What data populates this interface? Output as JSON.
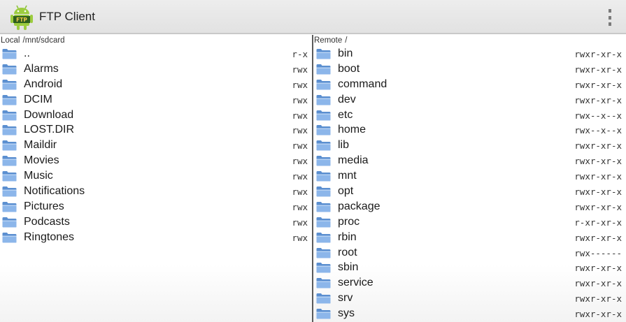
{
  "app": {
    "title": "FTP Client",
    "icon": "android-ftp-icon",
    "icon_text": "FTP"
  },
  "colors": {
    "actionbar": "#e6e6e6",
    "divider": "#5a5a5a",
    "folder": "#6f9fd8"
  },
  "local": {
    "label": "Local",
    "path": "/mnt/sdcard",
    "items": [
      {
        "name": "..",
        "perm": "r-x"
      },
      {
        "name": "Alarms",
        "perm": "rwx"
      },
      {
        "name": "Android",
        "perm": "rwx"
      },
      {
        "name": "DCIM",
        "perm": "rwx"
      },
      {
        "name": "Download",
        "perm": "rwx"
      },
      {
        "name": "LOST.DIR",
        "perm": "rwx"
      },
      {
        "name": "Maildir",
        "perm": "rwx"
      },
      {
        "name": "Movies",
        "perm": "rwx"
      },
      {
        "name": "Music",
        "perm": "rwx"
      },
      {
        "name": "Notifications",
        "perm": "rwx"
      },
      {
        "name": "Pictures",
        "perm": "rwx"
      },
      {
        "name": "Podcasts",
        "perm": "rwx"
      },
      {
        "name": "Ringtones",
        "perm": "rwx"
      }
    ]
  },
  "remote": {
    "label": "Remote",
    "path": "/",
    "items": [
      {
        "name": "bin",
        "perm": "rwxr-xr-x"
      },
      {
        "name": "boot",
        "perm": "rwxr-xr-x"
      },
      {
        "name": "command",
        "perm": "rwxr-xr-x"
      },
      {
        "name": "dev",
        "perm": "rwxr-xr-x"
      },
      {
        "name": "etc",
        "perm": "rwx--x--x"
      },
      {
        "name": "home",
        "perm": "rwx--x--x"
      },
      {
        "name": "lib",
        "perm": "rwxr-xr-x"
      },
      {
        "name": "media",
        "perm": "rwxr-xr-x"
      },
      {
        "name": "mnt",
        "perm": "rwxr-xr-x"
      },
      {
        "name": "opt",
        "perm": "rwxr-xr-x"
      },
      {
        "name": "package",
        "perm": "rwxr-xr-x"
      },
      {
        "name": "proc",
        "perm": "r-xr-xr-x"
      },
      {
        "name": "rbin",
        "perm": "rwxr-xr-x"
      },
      {
        "name": "root",
        "perm": "rwx------"
      },
      {
        "name": "sbin",
        "perm": "rwxr-xr-x"
      },
      {
        "name": "service",
        "perm": "rwxr-xr-x"
      },
      {
        "name": "srv",
        "perm": "rwxr-xr-x"
      },
      {
        "name": "sys",
        "perm": "rwxr-xr-x"
      }
    ]
  }
}
